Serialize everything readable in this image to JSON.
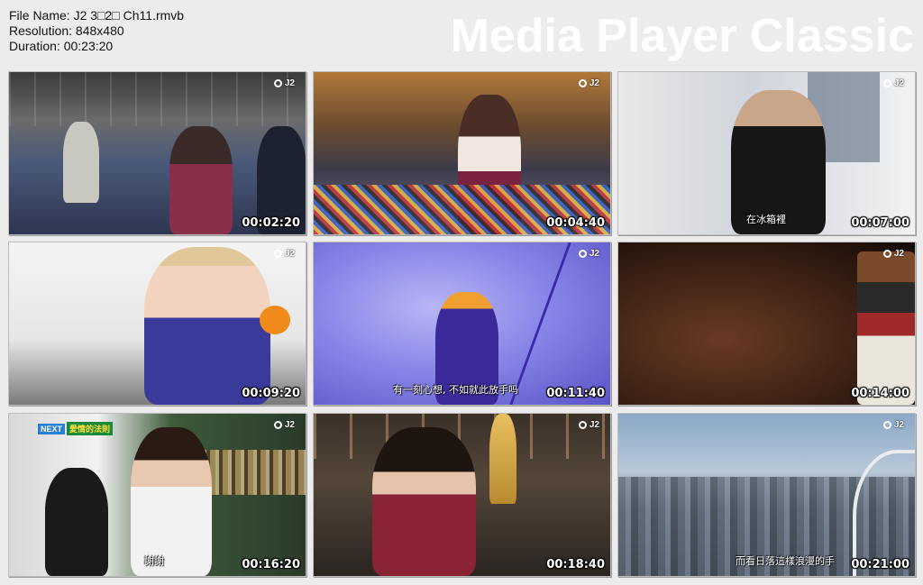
{
  "header": {
    "file_name": "File Name: J2 3□2□ Ch11.rmvb",
    "resolution": "Resolution: 848x480",
    "duration": "Duration: 00:23:20",
    "brand": "Media Player Classic"
  },
  "channel_logo": "J2",
  "thumbnails": [
    {
      "timestamp": "00:02:20",
      "subtitle": ""
    },
    {
      "timestamp": "00:04:40",
      "subtitle": ""
    },
    {
      "timestamp": "00:07:00",
      "subtitle": "在冰箱裡"
    },
    {
      "timestamp": "00:09:20",
      "subtitle": ""
    },
    {
      "timestamp": "00:11:40",
      "subtitle": "有一刻心想, 不如就此放手吗"
    },
    {
      "timestamp": "00:14:00",
      "subtitle": ""
    },
    {
      "timestamp": "00:16:20",
      "subtitle": "謝謝",
      "next_tag": "NEXT",
      "next_title": "愛情的法則"
    },
    {
      "timestamp": "00:18:40",
      "subtitle": ""
    },
    {
      "timestamp": "00:21:00",
      "subtitle": "而看日落這樣浪漫的手"
    }
  ]
}
